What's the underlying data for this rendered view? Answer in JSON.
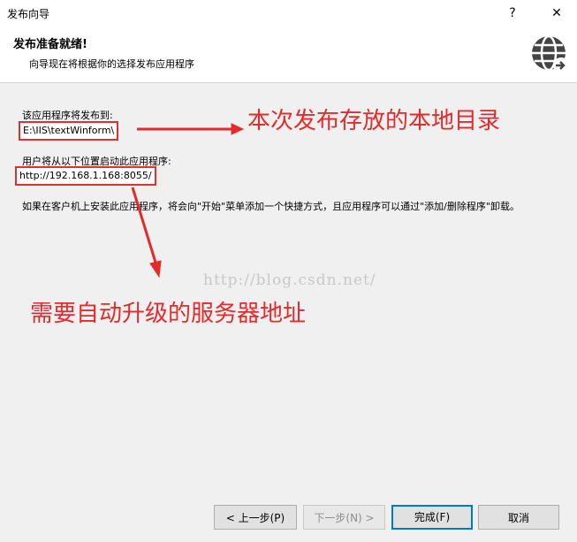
{
  "window": {
    "title": "发布向导",
    "help_label": "?",
    "close_label": "✕"
  },
  "header": {
    "title": "发布准备就绪!",
    "subtitle": "向导现在将根据你的选择发布应用程序",
    "icon": "globe-icon"
  },
  "body": {
    "publish_to_label": "该应用程序将发布到:",
    "publish_to_value": "E:\\IIS\\textWinform\\",
    "launch_from_label": "用户将从以下位置启动此应用程序:",
    "launch_from_value": "http://192.168.1.168:8055/",
    "info_text": "如果在客户机上安装此应用程序，将会向\"开始\"菜单添加一个快捷方式，且应用程序可以通过\"添加/删除程序\"卸载。"
  },
  "annotations": {
    "local_dir": "本次发布存放的本地目录",
    "update_server": "需要自动升级的服务器地址",
    "color": "#e32b2b"
  },
  "watermark": "http://blog.csdn.net/",
  "buttons": {
    "back": "< 上一步(P)",
    "next": "下一步(N) >",
    "finish": "完成(F)",
    "cancel": "取消"
  }
}
